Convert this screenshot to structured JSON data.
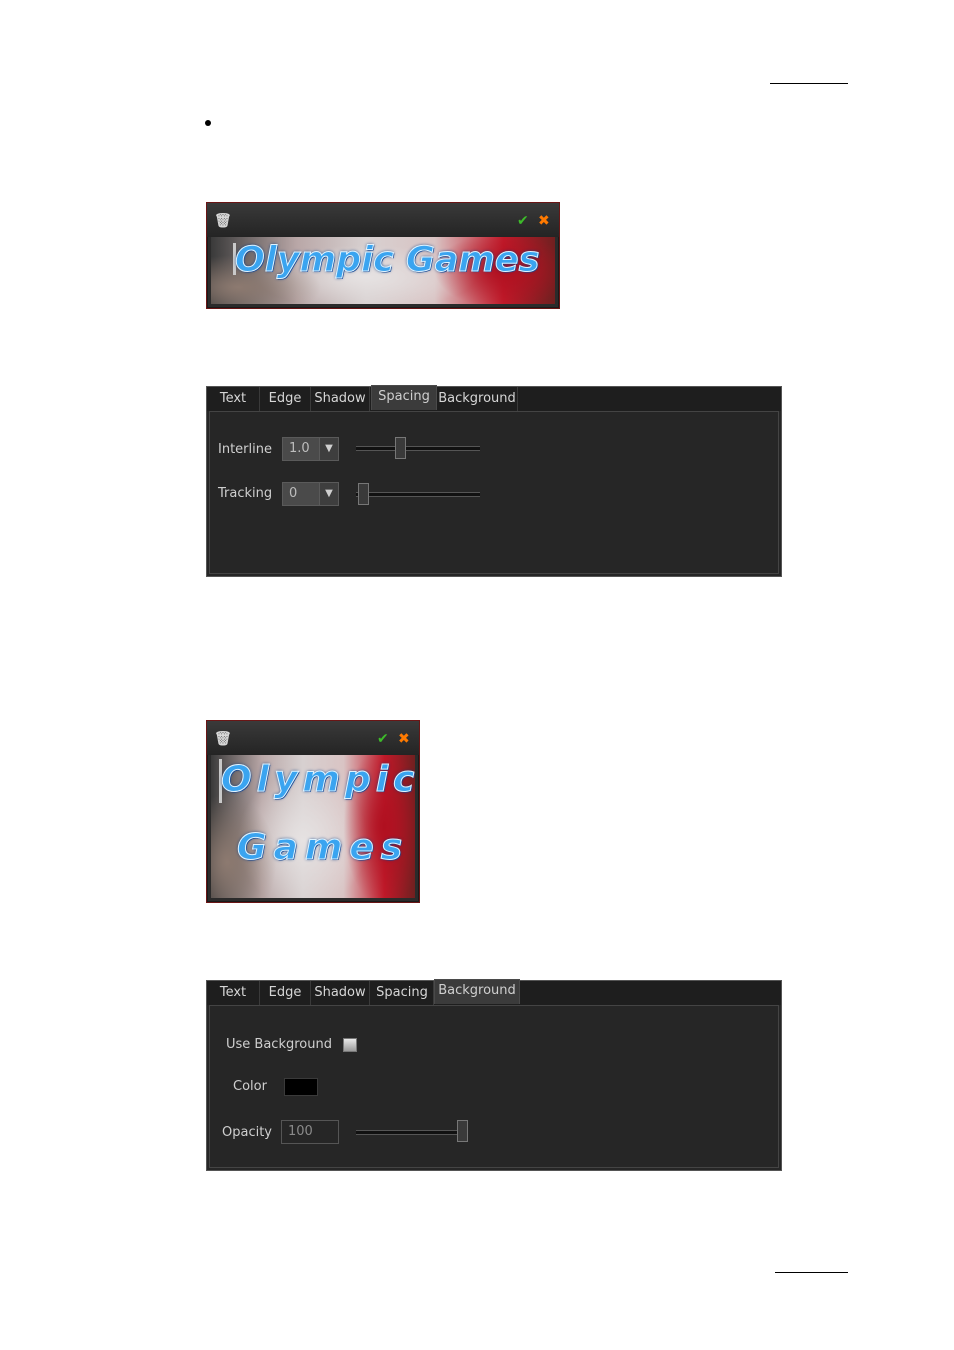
{
  "bullet": "•",
  "preview1": {
    "text": "Olympic Games",
    "icons": {
      "delete": "trash-icon",
      "apply": "check-icon",
      "cancel": "close-icon"
    },
    "glyph_trash": "🗑",
    "glyph_check": "✔",
    "glyph_close": "✖"
  },
  "panel1": {
    "tabs": [
      "Text",
      "Edge",
      "Shadow",
      "Spacing",
      "Background"
    ],
    "active_tab": "Spacing",
    "interline": {
      "label": "Interline",
      "value": "1.0",
      "slider_fraction": 0.35
    },
    "tracking": {
      "label": "Tracking",
      "value": "0",
      "slider_fraction": 0.0
    }
  },
  "preview2": {
    "line1": "Olympic",
    "line2": "Games",
    "glyph_trash": "🗑",
    "glyph_check": "✔",
    "glyph_close": "✖"
  },
  "panel2": {
    "tabs": [
      "Text",
      "Edge",
      "Shadow",
      "Spacing",
      "Background"
    ],
    "active_tab": "Background",
    "use_background": {
      "label": "Use Background",
      "checked": false
    },
    "color": {
      "label": "Color",
      "value": "#000000"
    },
    "opacity": {
      "label": "Opacity",
      "value": "100",
      "slider_fraction": 1.0
    }
  },
  "colors": {
    "check": "#3dbb2a",
    "close": "#ff7a00",
    "title_text": "#3aa4f0"
  }
}
